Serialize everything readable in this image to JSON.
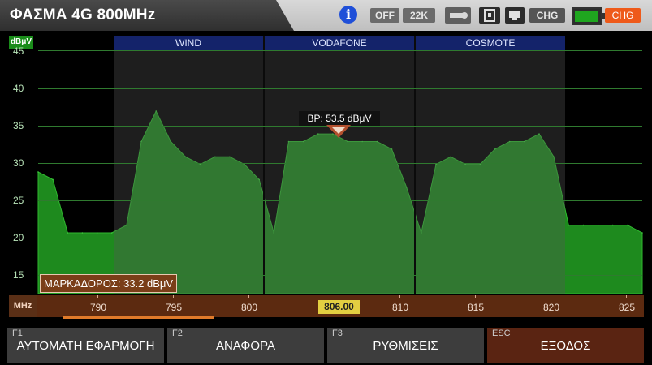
{
  "header": {
    "title": "ΦΑΣΜΑ 4G 800MHz",
    "info_glyph": "i",
    "off_label": "OFF",
    "k22_label": "22K",
    "chg1_label": "CHG",
    "chg2_label": "CHG",
    "battery_level": 0.95,
    "colors": {
      "accent": "#1fa61f",
      "warn": "#ee5a1a"
    }
  },
  "plot": {
    "unit": "dBμV",
    "y_ticks": [
      "45",
      "40",
      "35",
      "30",
      "25",
      "20",
      "15"
    ],
    "bands": [
      "WIND",
      "VODAFONE",
      "COSMOTE"
    ],
    "bp_label": "BP: 53.5 dBμV",
    "marker_readout": "ΜΑΡΚΑΔΟΡΟΣ: 33.2 dBμV"
  },
  "xaxis": {
    "unit": "MHz",
    "ticks": [
      "790",
      "795",
      "800",
      "810",
      "815",
      "820",
      "825"
    ],
    "center": "806.00"
  },
  "footer": {
    "f1": {
      "key": "F1",
      "label": "ΑΥΤΟΜΑΤΗ ΕΦΑΡΜΟΓΗ"
    },
    "f2": {
      "key": "F2",
      "label": "ΑΝΑΦΟΡΑ"
    },
    "f3": {
      "key": "F3",
      "label": "ΡΥΘΜΙΣΕΙΣ"
    },
    "esc": {
      "key": "ESC",
      "label": "ΕΞΟΔΟΣ"
    }
  },
  "chart_data": {
    "type": "area",
    "x_unit": "MHz",
    "y_unit": "dBμV",
    "xlim": [
      785,
      826
    ],
    "ylim": [
      13,
      45
    ],
    "x": [
      785,
      786,
      787,
      788,
      789,
      790,
      791,
      792,
      793,
      794,
      795,
      796,
      797,
      798,
      799,
      800,
      801,
      802,
      803,
      804,
      805,
      806,
      807,
      808,
      809,
      810,
      811,
      812,
      813,
      814,
      815,
      816,
      817,
      818,
      819,
      820,
      821,
      822,
      823,
      824,
      825,
      826
    ],
    "y": [
      29,
      28,
      21,
      21,
      21,
      21,
      22,
      33,
      37,
      33,
      31,
      30,
      31,
      31,
      30,
      28,
      21,
      33,
      33,
      34,
      34,
      33,
      33,
      33,
      32,
      27,
      21,
      30,
      31,
      30,
      30,
      32,
      33,
      33,
      34,
      31,
      22,
      22,
      22,
      22,
      22,
      21
    ]
  }
}
